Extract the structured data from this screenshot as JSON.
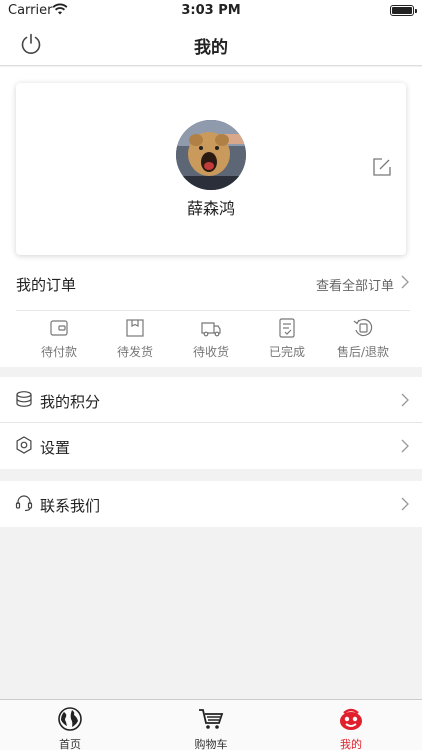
{
  "status_bar": {
    "carrier": "Carrier",
    "time": "3:03 PM"
  },
  "nav": {
    "title": "我的"
  },
  "profile": {
    "name": "薛森鸿"
  },
  "orders": {
    "title": "我的订单",
    "view_all": "查看全部订单",
    "items": [
      {
        "label": "待付款",
        "icon": "wallet-icon"
      },
      {
        "label": "待发货",
        "icon": "package-icon"
      },
      {
        "label": "待收货",
        "icon": "truck-icon"
      },
      {
        "label": "已完成",
        "icon": "checklist-icon"
      },
      {
        "label": "售后/退款",
        "icon": "refund-icon"
      }
    ]
  },
  "menu": {
    "points": "我的积分",
    "settings": "设置",
    "contact": "联系我们"
  },
  "tabbar": {
    "home": "首页",
    "cart": "购物车",
    "mine": "我的"
  },
  "colors": {
    "accent": "#e0202c",
    "background": "#f2f2f2"
  }
}
